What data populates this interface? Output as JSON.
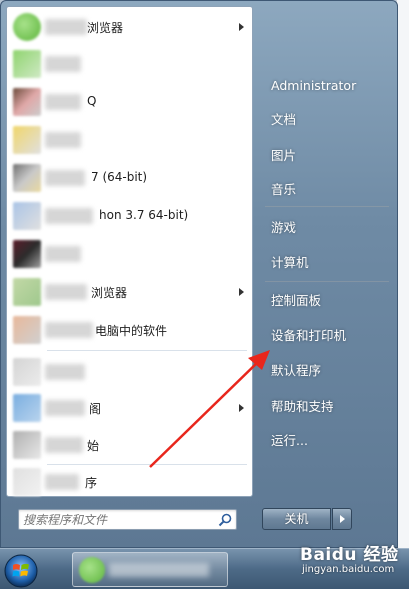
{
  "start_menu": {
    "programs": [
      {
        "label": "浏览器",
        "has_submenu": true
      },
      {
        "label": "",
        "has_submenu": false
      },
      {
        "label": "Q",
        "has_submenu": false
      },
      {
        "label": "",
        "has_submenu": false
      },
      {
        "label": "7 (64-bit)",
        "has_submenu": false
      },
      {
        "label": "hon 3.7 64-bit)",
        "has_submenu": false
      },
      {
        "label": "",
        "has_submenu": false
      },
      {
        "label": "浏览器",
        "has_submenu": true
      },
      {
        "label": "电脑中的软件",
        "has_submenu": false
      },
      {
        "label": "",
        "has_submenu": false
      },
      {
        "label": "阁",
        "has_submenu": true
      },
      {
        "label": "始",
        "has_submenu": false
      },
      {
        "label": "序",
        "has_submenu": false
      }
    ],
    "search": {
      "placeholder": "搜索程序和文件"
    },
    "right_items": [
      "Administrator",
      "文档",
      "图片",
      "音乐",
      "游戏",
      "计算机",
      "控制面板",
      "设备和打印机",
      "默认程序",
      "帮助和支持",
      "运行..."
    ],
    "shutdown_label": "关机"
  },
  "watermark": {
    "brand": "Baidu 经验",
    "url": "jingyan.baidu.com"
  },
  "colors": {
    "annotation_arrow": "#e8261c"
  }
}
